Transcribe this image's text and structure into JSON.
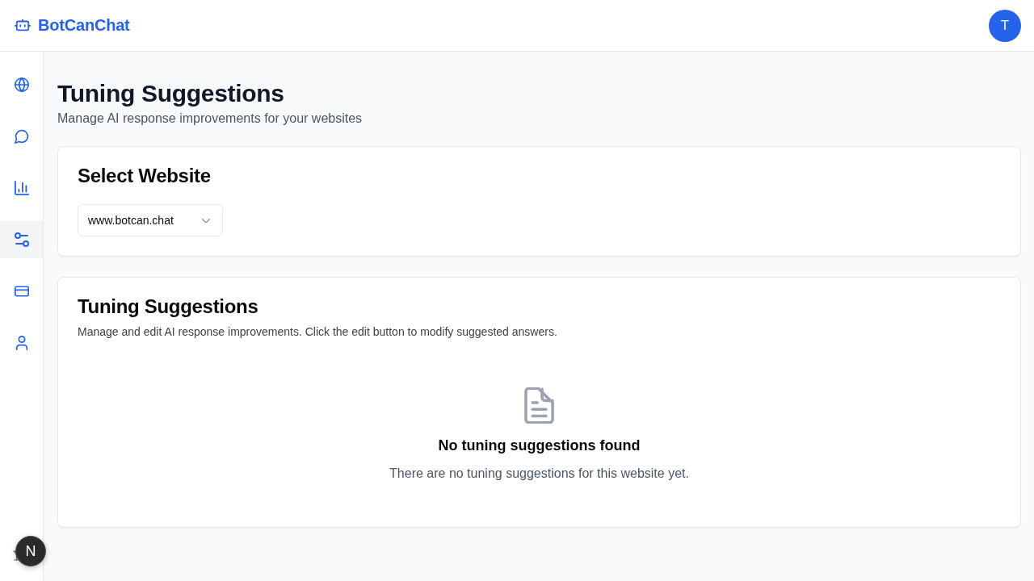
{
  "header": {
    "logo_text": "BotCanChat",
    "avatar_initial": "T"
  },
  "sidebar": {
    "items": [
      {
        "selected": false
      },
      {
        "selected": false
      },
      {
        "selected": false
      },
      {
        "selected": true
      },
      {
        "selected": false
      },
      {
        "selected": false
      }
    ]
  },
  "page": {
    "title": "Tuning Suggestions",
    "subtitle": "Manage AI response improvements for your websites"
  },
  "website_card": {
    "title": "Select Website",
    "select": {
      "value": "www.botcan.chat"
    }
  },
  "suggestions_card": {
    "title": "Tuning Suggestions",
    "description": "Manage and edit AI response improvements. Click the edit button to modify suggested answers.",
    "empty_state": {
      "title": "No tuning suggestions found",
      "message": "There are no tuning suggestions for this website yet."
    }
  },
  "dev_badge": {
    "label": "N"
  }
}
